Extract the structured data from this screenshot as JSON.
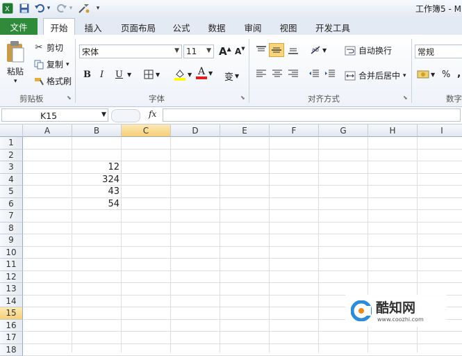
{
  "title_bar": {
    "app_title": "工作簿5 - M",
    "qat_icons": [
      "excel-icon",
      "save-icon",
      "undo-icon",
      "redo-icon",
      "tools-icon",
      "customize-icon"
    ],
    "undo_arrow": "▾",
    "redo_arrow": "▾",
    "customize_glyph": "▾"
  },
  "tabs": {
    "file": "文件",
    "items": [
      "开始",
      "插入",
      "页面布局",
      "公式",
      "数据",
      "审阅",
      "视图",
      "开发工具"
    ],
    "active_index": 0
  },
  "ribbon": {
    "clipboard": {
      "label": "剪贴板",
      "paste": "粘贴",
      "paste_arrow": "▾",
      "cut": "剪切",
      "copy": "复制",
      "copy_arrow": "▾",
      "format_painter": "格式刷"
    },
    "font": {
      "label": "字体",
      "font_name": "宋体",
      "font_size": "11",
      "grow": "A",
      "shrink": "A",
      "bold": "B",
      "italic": "I",
      "underline": "U",
      "wen": "变",
      "font_color_glyph": "A",
      "fill_color": "#ffff00",
      "font_color": "#e02020"
    },
    "alignment": {
      "label": "对齐方式",
      "wrap_text": "自动换行",
      "merge_center": "合并后居中",
      "merge_arrow": "▾"
    },
    "number": {
      "label": "数字",
      "format": "常规",
      "percent": "%",
      "comma": ","
    }
  },
  "formula_bar": {
    "name_box": "K15",
    "fx": "fx",
    "formula": ""
  },
  "sheet": {
    "columns": [
      "A",
      "B",
      "C",
      "D",
      "E",
      "F",
      "G",
      "H",
      "I"
    ],
    "selected_column": "C",
    "rows": [
      "1",
      "2",
      "3",
      "4",
      "5",
      "6",
      "7",
      "8",
      "9",
      "10",
      "11",
      "12",
      "13",
      "14",
      "15",
      "16",
      "17",
      "18"
    ],
    "selected_row": "15",
    "cells": [
      {
        "ref": "B3",
        "value": "12"
      },
      {
        "ref": "B4",
        "value": "324"
      },
      {
        "ref": "B5",
        "value": "43"
      },
      {
        "ref": "B6",
        "value": "54"
      }
    ]
  },
  "watermark": {
    "brand": "酷知网",
    "url": "www.coozhi.com",
    "logo_color": "#2e8bd8",
    "logo_accent": "#f08a1c"
  }
}
